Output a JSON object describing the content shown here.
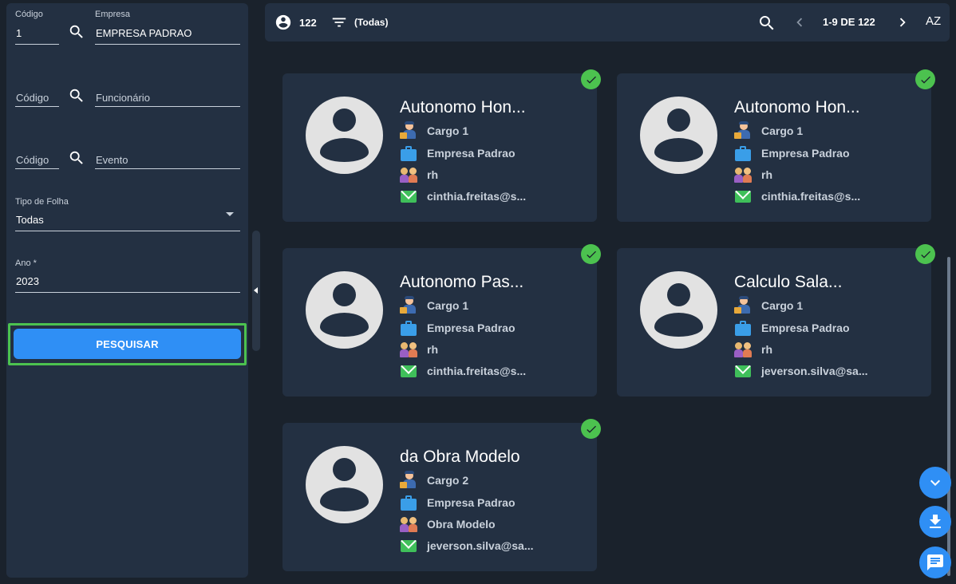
{
  "filters": {
    "empresa": {
      "codigo_label": "Código",
      "codigo_value": "1",
      "name_label": "Empresa",
      "name_value": "EMPRESA PADRAO"
    },
    "funcionario": {
      "codigo_placeholder": "Código",
      "name_placeholder": "Funcionário"
    },
    "evento": {
      "codigo_placeholder": "Código",
      "name_placeholder": "Evento"
    },
    "tipo_folha": {
      "label": "Tipo de Folha",
      "value": "Todas"
    },
    "ano": {
      "label": "Ano *",
      "value": "2023"
    },
    "search_button": "PESQUISAR"
  },
  "toolbar": {
    "count": "122",
    "filter_value": "(Todas)",
    "pagination": "1-9 DE 122",
    "sort_label": "AZ"
  },
  "cards": [
    {
      "name": "Autonomo Hon...",
      "cargo": "Cargo 1",
      "empresa": "Empresa Padrao",
      "departamento": "rh",
      "email": "cinthia.freitas@s..."
    },
    {
      "name": "Autonomo Hon...",
      "cargo": "Cargo 1",
      "empresa": "Empresa Padrao",
      "departamento": "rh",
      "email": "cinthia.freitas@s..."
    },
    {
      "name": "Autonomo Pas...",
      "cargo": "Cargo 1",
      "empresa": "Empresa Padrao",
      "departamento": "rh",
      "email": "cinthia.freitas@s..."
    },
    {
      "name": "Calculo Sala...",
      "cargo": "Cargo 1",
      "empresa": "Empresa Padrao",
      "departamento": "rh",
      "email": "jeverson.silva@sa..."
    },
    {
      "name": "da Obra Modelo",
      "cargo": "Cargo 2",
      "empresa": "Empresa Padrao",
      "departamento": "Obra Modelo",
      "email": "jeverson.silva@sa..."
    }
  ],
  "icons": {
    "person": "account-circle-icon",
    "filter": "filter-icon",
    "search": "search-icon",
    "prev": "chevron-left-icon",
    "next": "chevron-right-icon",
    "sort": "sort-az-icon",
    "check": "check-circle-icon",
    "fab_down": "chevron-down-icon",
    "fab_download": "download-icon",
    "fab_chat": "chat-icon"
  },
  "colors": {
    "background": "#1a222c",
    "panel": "#233042",
    "accent": "#2f8ff5",
    "success": "#4cc24f"
  }
}
